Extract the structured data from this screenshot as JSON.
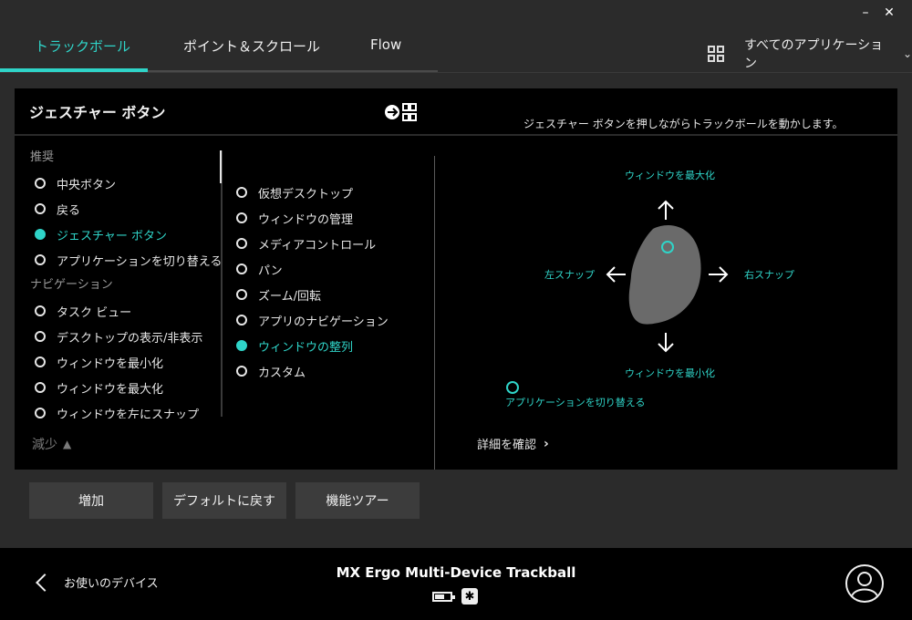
{
  "window": {
    "minimize_glyph": "–",
    "close_glyph": "✕"
  },
  "tabs": [
    {
      "label": "トラックボール",
      "active": true
    },
    {
      "label": "ポイント＆スクロール",
      "active": false
    },
    {
      "label": "Flow",
      "active": false
    }
  ],
  "app_selector": {
    "icon": "grid-icon",
    "label": "すべてのアプリケーション",
    "chevron": "⌄"
  },
  "panel": {
    "title": "ジェスチャー ボタン",
    "hint": "ジェスチャー ボタンを押しながらトラックボールを動かします。",
    "col1": {
      "section_recommended": "推奨",
      "recommended": [
        {
          "label": "中央ボタン",
          "selected": false
        },
        {
          "label": "戻る",
          "selected": false
        },
        {
          "label": "ジェスチャー ボタン",
          "selected": true
        },
        {
          "label": "アプリケーションを切り替える",
          "selected": false
        }
      ],
      "section_navigation": "ナビゲーション",
      "navigation": [
        {
          "label": "タスク ビュー",
          "selected": false
        },
        {
          "label": "デスクトップの表示/非表示",
          "selected": false
        },
        {
          "label": "ウィンドウを最小化",
          "selected": false
        },
        {
          "label": "ウィンドウを最大化",
          "selected": false
        },
        {
          "label": "ウィンドウを左にスナップ",
          "selected": false
        }
      ]
    },
    "col2": [
      {
        "label": "仮想デスクトップ",
        "selected": false
      },
      {
        "label": "ウィンドウの管理",
        "selected": false
      },
      {
        "label": "メディアコントロール",
        "selected": false
      },
      {
        "label": "パン",
        "selected": false
      },
      {
        "label": "ズーム/回転",
        "selected": false
      },
      {
        "label": "アプリのナビゲーション",
        "selected": false
      },
      {
        "label": "ウィンドウの整列",
        "selected": true
      },
      {
        "label": "カスタム",
        "selected": false
      }
    ],
    "collapse_label": "減少",
    "gesture": {
      "up": "ウィンドウを最大化",
      "down": "ウィンドウを最小化",
      "left": "左スナップ",
      "right": "右スナップ",
      "click": "アプリケーションを切り替える"
    },
    "details_label": "詳細を確認"
  },
  "buttons": {
    "add": "増加",
    "reset": "デフォルトに戻す",
    "tour": "機能ツアー"
  },
  "footer": {
    "back_label": "お使いのデバイス",
    "device_name": "MX Ergo Multi-Device Trackball",
    "battery_level": 0.65,
    "receiver_icon": "unifying-receiver-icon"
  },
  "colors": {
    "accent": "#2fd4c8",
    "panel": "#000000",
    "background": "#2b2b2b",
    "button": "#3c3c3c"
  }
}
